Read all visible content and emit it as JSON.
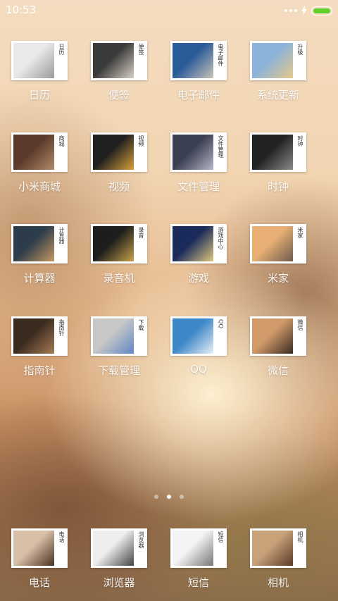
{
  "status": {
    "time": "10:53"
  },
  "pager": {
    "pages": 3,
    "active": 1
  },
  "apps": [
    {
      "label": "日历",
      "tile_text": "日历",
      "icon": "calendar-icon"
    },
    {
      "label": "便签",
      "tile_text": "便签",
      "icon": "notes-icon"
    },
    {
      "label": "电子邮件",
      "tile_text": "电子邮件",
      "icon": "email-icon"
    },
    {
      "label": "系统更新",
      "tile_text": "升级",
      "icon": "update-icon"
    },
    {
      "label": "小米商城",
      "tile_text": "商城",
      "icon": "mall-icon"
    },
    {
      "label": "视频",
      "tile_text": "视频",
      "icon": "video-icon"
    },
    {
      "label": "文件管理",
      "tile_text": "文件管理",
      "icon": "files-icon"
    },
    {
      "label": "时钟",
      "tile_text": "时钟",
      "icon": "clock-icon"
    },
    {
      "label": "计算器",
      "tile_text": "计算器",
      "icon": "calculator-icon"
    },
    {
      "label": "录音机",
      "tile_text": "录音",
      "icon": "recorder-icon"
    },
    {
      "label": "游戏",
      "tile_text": "游戏中心",
      "icon": "game-icon"
    },
    {
      "label": "米家",
      "tile_text": "米家",
      "icon": "mijia-icon"
    },
    {
      "label": "指南针",
      "tile_text": "指南针",
      "icon": "compass-icon"
    },
    {
      "label": "下载管理",
      "tile_text": "下载",
      "icon": "download-icon"
    },
    {
      "label": "QQ",
      "tile_text": "QQ",
      "icon": "qq-icon"
    },
    {
      "label": "微信",
      "tile_text": "微信",
      "icon": "wechat-icon"
    }
  ],
  "dock": [
    {
      "label": "电话",
      "tile_text": "电话",
      "icon": "phone-icon"
    },
    {
      "label": "浏览器",
      "tile_text": "浏览器",
      "icon": "browser-icon"
    },
    {
      "label": "短信",
      "tile_text": "短信",
      "icon": "sms-icon"
    },
    {
      "label": "相机",
      "tile_text": "相机",
      "icon": "camera-icon"
    }
  ],
  "colors": {
    "battery": "#5fd22c"
  }
}
